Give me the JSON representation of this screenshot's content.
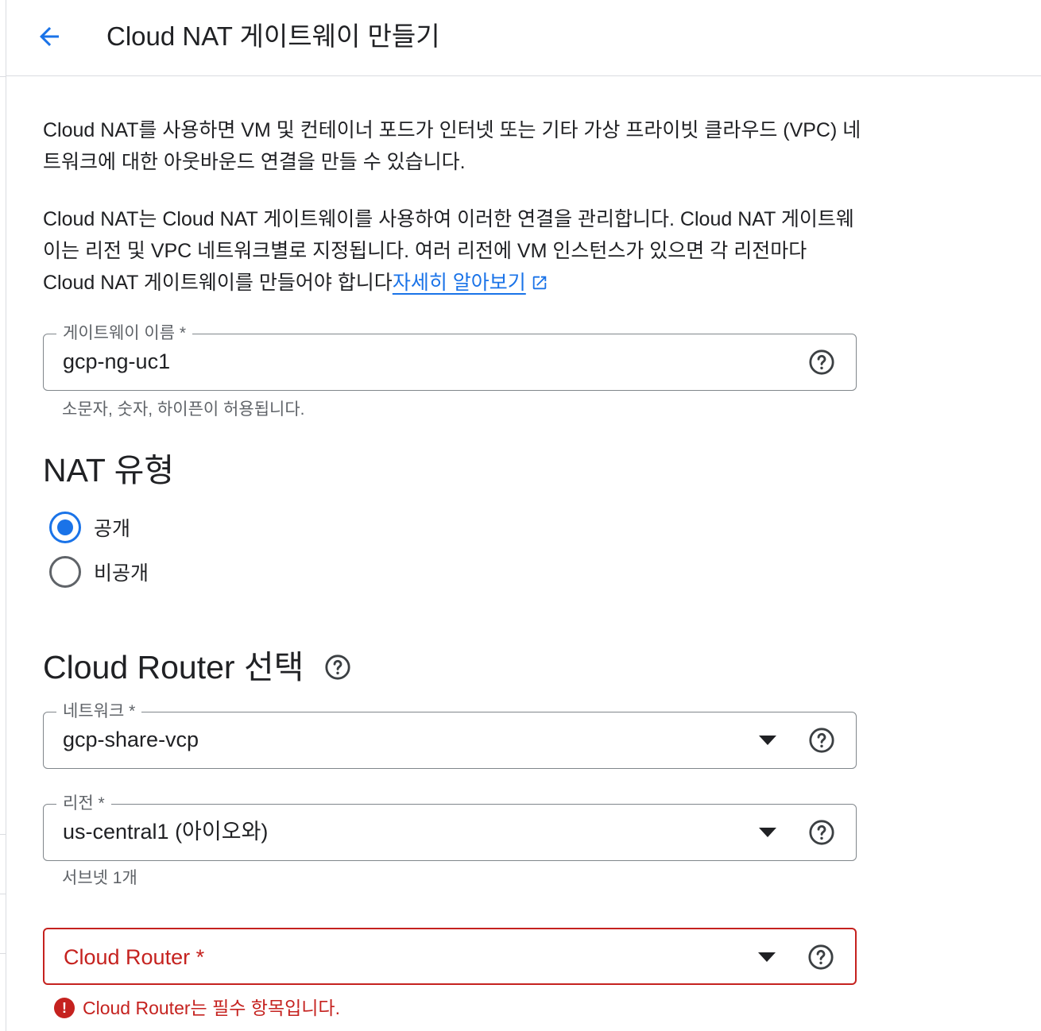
{
  "header": {
    "title": "Cloud NAT 게이트웨이 만들기",
    "back_icon": "arrow-back-icon"
  },
  "intro": {
    "para1": "Cloud NAT를 사용하면 VM 및 컨테이너 포드가 인터넷 또는 기타 가상 프라이빗 클라우드 (VPC) 네트워크에 대한 아웃바운드 연결을 만들 수 있습니다.",
    "para2": "Cloud NAT는 Cloud NAT 게이트웨이를 사용하여 이러한 연결을 관리합니다. Cloud NAT 게이트웨이는 리전 및 VPC 네트워크별로 지정됩니다. 여러 리전에 VM 인스턴스가 있으면 각 리전마다 Cloud NAT 게이트웨이를 만들어야 합니다",
    "learn_more": "자세히 알아보기"
  },
  "gateway_name": {
    "label": "게이트웨이 이름 *",
    "value": "gcp-ng-uc1",
    "hint": "소문자, 숫자, 하이픈이 허용됩니다."
  },
  "nat_type": {
    "title": "NAT 유형",
    "options": [
      {
        "label": "공개",
        "selected": true
      },
      {
        "label": "비공개",
        "selected": false
      }
    ]
  },
  "router_section": {
    "title": "Cloud Router 선택"
  },
  "network": {
    "label": "네트워크 *",
    "value": "gcp-share-vcp"
  },
  "region": {
    "label": "리전 *",
    "value": "us-central1 (아이오와)",
    "hint": "서브넷 1개"
  },
  "cloud_router": {
    "placeholder": "Cloud Router *",
    "error": "Cloud Router는 필수 항목입니다."
  },
  "colors": {
    "accent": "#1a73e8",
    "error": "#c5221f",
    "border": "#80868b",
    "text": "#202124",
    "secondary_text": "#5f6368"
  }
}
